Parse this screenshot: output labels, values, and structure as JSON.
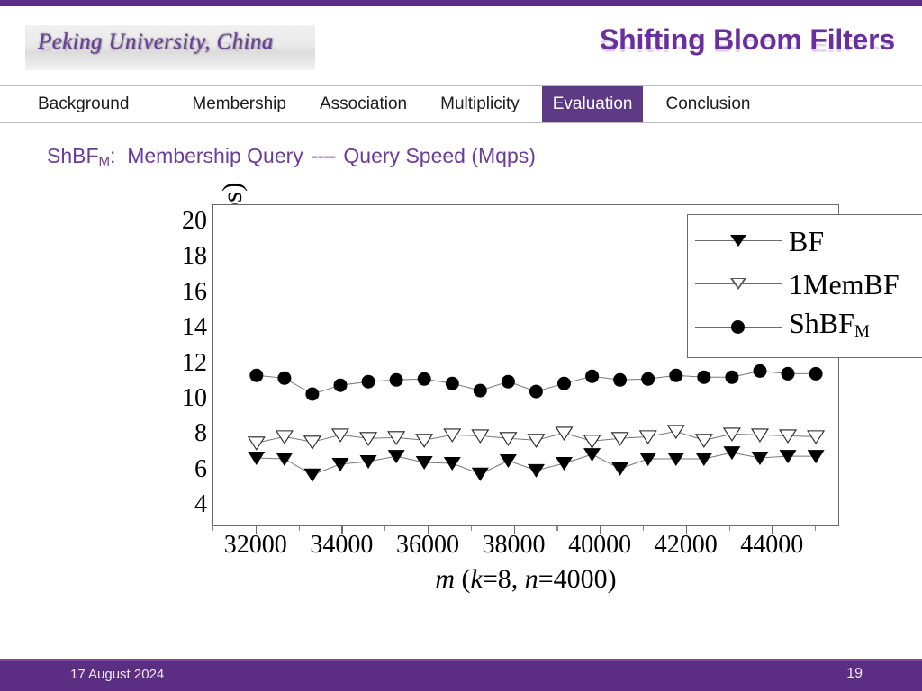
{
  "top_bar_color": "#5b2d83",
  "header": {
    "logo_text": "Peking University, China",
    "title": "Shifting Bloom Filters",
    "title_color": "#6a2f9e"
  },
  "nav": {
    "active_color": "#5f3a84",
    "items": [
      {
        "label": "Background",
        "active": false
      },
      {
        "label": "Membership",
        "active": false
      },
      {
        "label": "Association",
        "active": false
      },
      {
        "label": "Multiplicity",
        "active": false
      },
      {
        "label": "Evaluation",
        "active": true
      },
      {
        "label": "Conclusion",
        "active": false
      }
    ]
  },
  "subtitle": {
    "prefix": "ShBF",
    "subscript": "M",
    "colon": ":",
    "part1": "Membership Query",
    "separator": "----",
    "part2": "Query Speed (Mqps)",
    "color": "#6a3d9a"
  },
  "footer": {
    "date": "17 August 2024",
    "page": "19",
    "background": "#5b2d83"
  },
  "chart_data": {
    "type": "line",
    "title": "",
    "xlabel_parts": {
      "m": "m",
      "open": "  (",
      "k": "k",
      "keq": "=8, ",
      "n": "n",
      "neq": "=4000)"
    },
    "xlabel": "m  (k=8, n=4000)",
    "ylabel": "Query speed  (Mqps)",
    "xlim": [
      31000,
      45500
    ],
    "ylim": [
      3,
      21
    ],
    "xticks": [
      32000,
      34000,
      36000,
      38000,
      40000,
      42000,
      44000
    ],
    "yticks": [
      4,
      6,
      8,
      10,
      12,
      14,
      16,
      18,
      20
    ],
    "grid": false,
    "legend_position": "top-right",
    "x": [
      32000,
      32650,
      33300,
      33950,
      34600,
      35250,
      35900,
      36550,
      37200,
      37850,
      38500,
      39150,
      39800,
      40450,
      41100,
      41750,
      42400,
      43050,
      43700,
      44350,
      45000
    ],
    "series": [
      {
        "name": "BF",
        "marker": "filled-triangle-down",
        "values": [
          6.75,
          6.7,
          5.8,
          6.4,
          6.55,
          6.85,
          6.5,
          6.45,
          5.85,
          6.6,
          6.05,
          6.45,
          6.95,
          6.15,
          6.7,
          6.7,
          6.7,
          7.05,
          6.75,
          6.85,
          6.85
        ]
      },
      {
        "name": "1MemBF",
        "marker": "open-triangle-down",
        "values": [
          7.6,
          7.95,
          7.65,
          8.05,
          7.85,
          7.9,
          7.75,
          8.05,
          8.0,
          7.85,
          7.75,
          8.15,
          7.7,
          7.85,
          7.95,
          8.25,
          7.75,
          8.1,
          8.05,
          8.0,
          7.95
        ]
      },
      {
        "name": "ShBF_M",
        "marker": "filled-circle",
        "values": [
          11.4,
          11.25,
          10.35,
          10.85,
          11.05,
          11.15,
          11.2,
          10.95,
          10.55,
          11.05,
          10.5,
          10.95,
          11.35,
          11.15,
          11.2,
          11.4,
          11.3,
          11.3,
          11.65,
          11.5,
          11.5
        ]
      }
    ],
    "legend": [
      {
        "label_main": "BF",
        "label_sub": "",
        "marker": "filled-triangle-down"
      },
      {
        "label_main": "1MemBF",
        "label_sub": "",
        "marker": "open-triangle-down"
      },
      {
        "label_main": "ShBF",
        "label_sub": "M",
        "marker": "filled-circle"
      }
    ]
  }
}
